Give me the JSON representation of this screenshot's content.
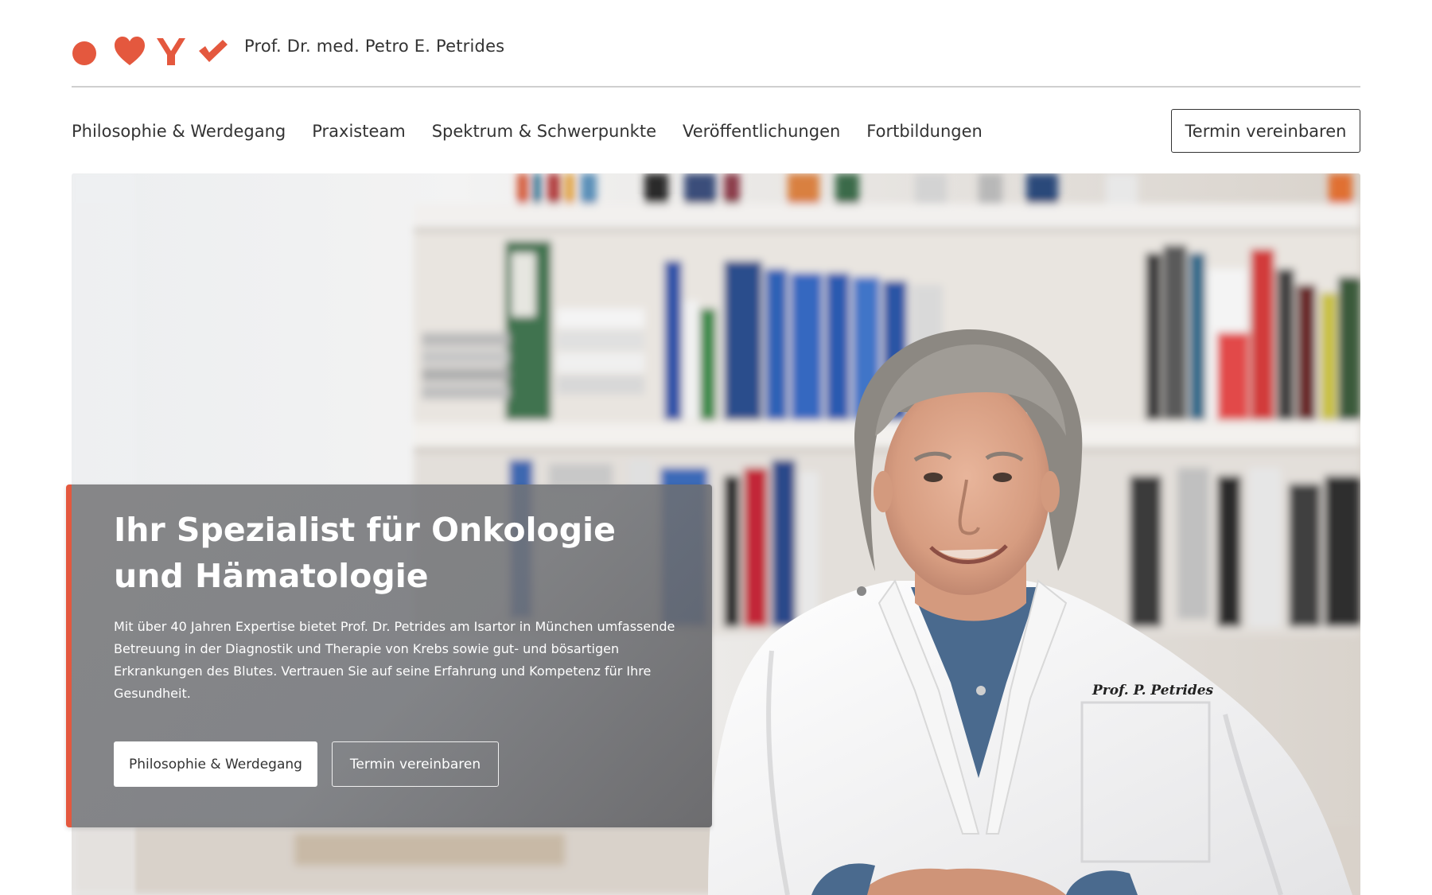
{
  "brand": {
    "name": "Prof. Dr. med. Petro E. Petrides",
    "accent_color": "#e4583e",
    "logo_icons": [
      "circle-icon",
      "heart-icon",
      "antibody-icon",
      "checkmark-icon"
    ]
  },
  "nav": {
    "items": [
      {
        "label": "Philosophie & Werdegang"
      },
      {
        "label": "Praxisteam"
      },
      {
        "label": "Spektrum & Schwerpunkte"
      },
      {
        "label": "Veröffentlichungen"
      },
      {
        "label": "Fortbildungen"
      }
    ],
    "cta_label": "Termin vereinbaren"
  },
  "hero": {
    "title": "Ihr Spezialist für Onkologie und Hämatologie",
    "description": "Mit über 40 Jahren Expertise bietet Prof. Dr. Petrides am Isartor in München umfassende Betreuung in der Diagnostik und Therapie von Krebs sowie gut- und bösartigen Erkrankungen des Blutes. Vertrauen Sie auf seine Erfahrung und Kompetenz für Ihre Gesundheit.",
    "primary_button": "Philosophie & Werdegang",
    "secondary_button": "Termin vereinbaren",
    "coat_embroidery": "Prof. P. Petrides"
  }
}
